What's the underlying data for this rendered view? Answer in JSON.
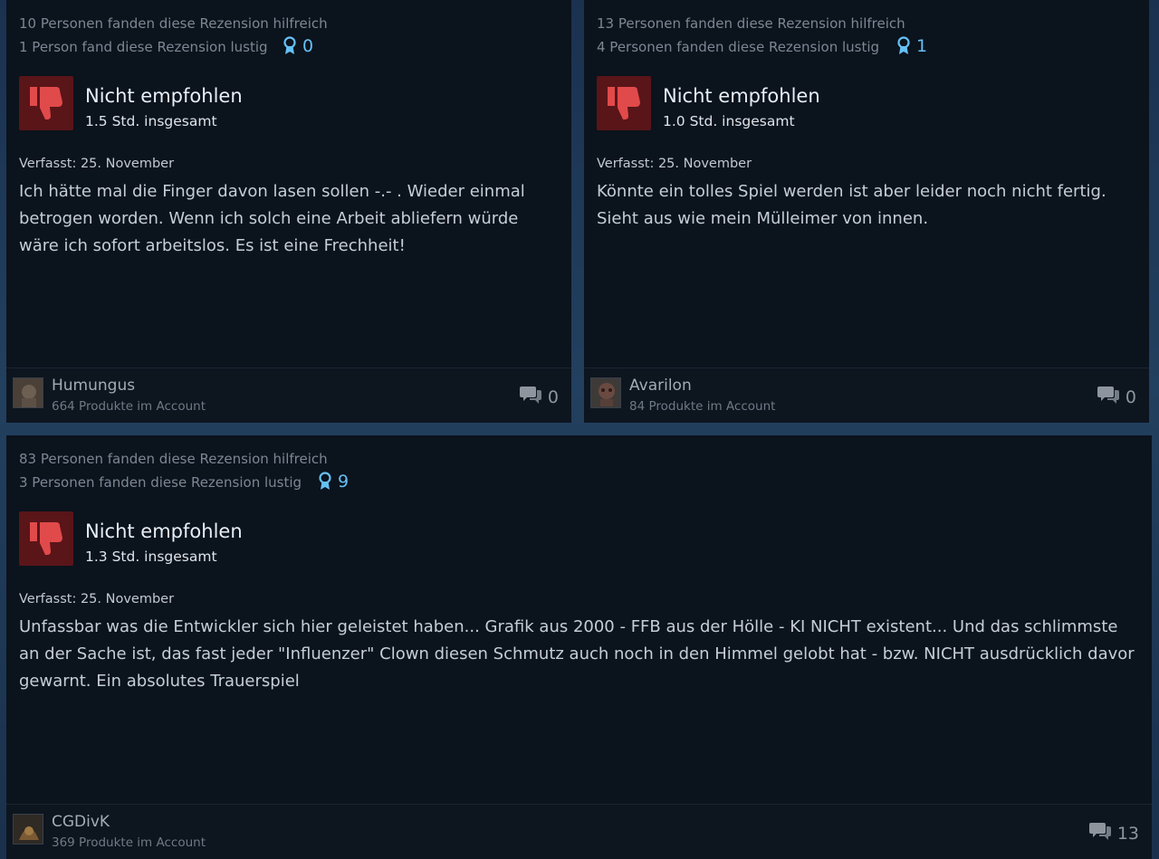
{
  "reviews": [
    {
      "helpful": "10 Personen fanden diese Rezension hilfreich",
      "funny": "1 Person fand diese Rezension lustig",
      "awards": "0",
      "verdict": "Nicht empfohlen",
      "hours": "1.5 Std. insgesamt",
      "posted": "Verfasst: 25. November",
      "text": "Ich hätte mal die Finger davon lasen sollen -.- . Wieder einmal betrogen worden. Wenn ich solch eine Arbeit abliefern würde wäre ich sofort arbeitslos. Es ist eine Frechheit!",
      "author": "Humungus",
      "products": "664 Produkte im Account",
      "comments": "0"
    },
    {
      "helpful": "13 Personen fanden diese Rezension hilfreich",
      "funny": "4 Personen fanden diese Rezension lustig",
      "awards": "1",
      "verdict": "Nicht empfohlen",
      "hours": "1.0 Std. insgesamt",
      "posted": "Verfasst: 25. November",
      "text": "Könnte ein tolles Spiel werden ist aber leider noch nicht fertig. Sieht aus wie mein Mülleimer von innen.",
      "author": "Avarilon",
      "products": "84 Produkte im Account",
      "comments": "0"
    },
    {
      "helpful": "83 Personen fanden diese Rezension hilfreich",
      "funny": "3 Personen fanden diese Rezension lustig",
      "awards": "9",
      "verdict": "Nicht empfohlen",
      "hours": "1.3 Std. insgesamt",
      "posted": "Verfasst: 25. November",
      "text": "Unfassbar was die Entwickler sich hier geleistet haben... Grafik aus 2000 - FFB aus der Hölle - KI NICHT existent... Und das schlimmste an der Sache ist, das fast jeder \"Influenzer\" Clown diesen Schmutz auch noch in den Himmel gelobt hat - bzw. NICHT ausdrücklich davor gewarnt. Ein absolutes Trauerspiel",
      "author": "CGDivK",
      "products": "369 Produkte im Account",
      "comments": "13"
    }
  ],
  "icons": {
    "award": "award-ribbon-icon",
    "thumb": "thumbs-down-icon",
    "comment": "comment-bubbles-icon"
  },
  "colors": {
    "card_bg": "#0b131d",
    "award": "#66c0f4",
    "thumb_bg": "#5a1519",
    "thumb_fg": "#e14a4a"
  }
}
